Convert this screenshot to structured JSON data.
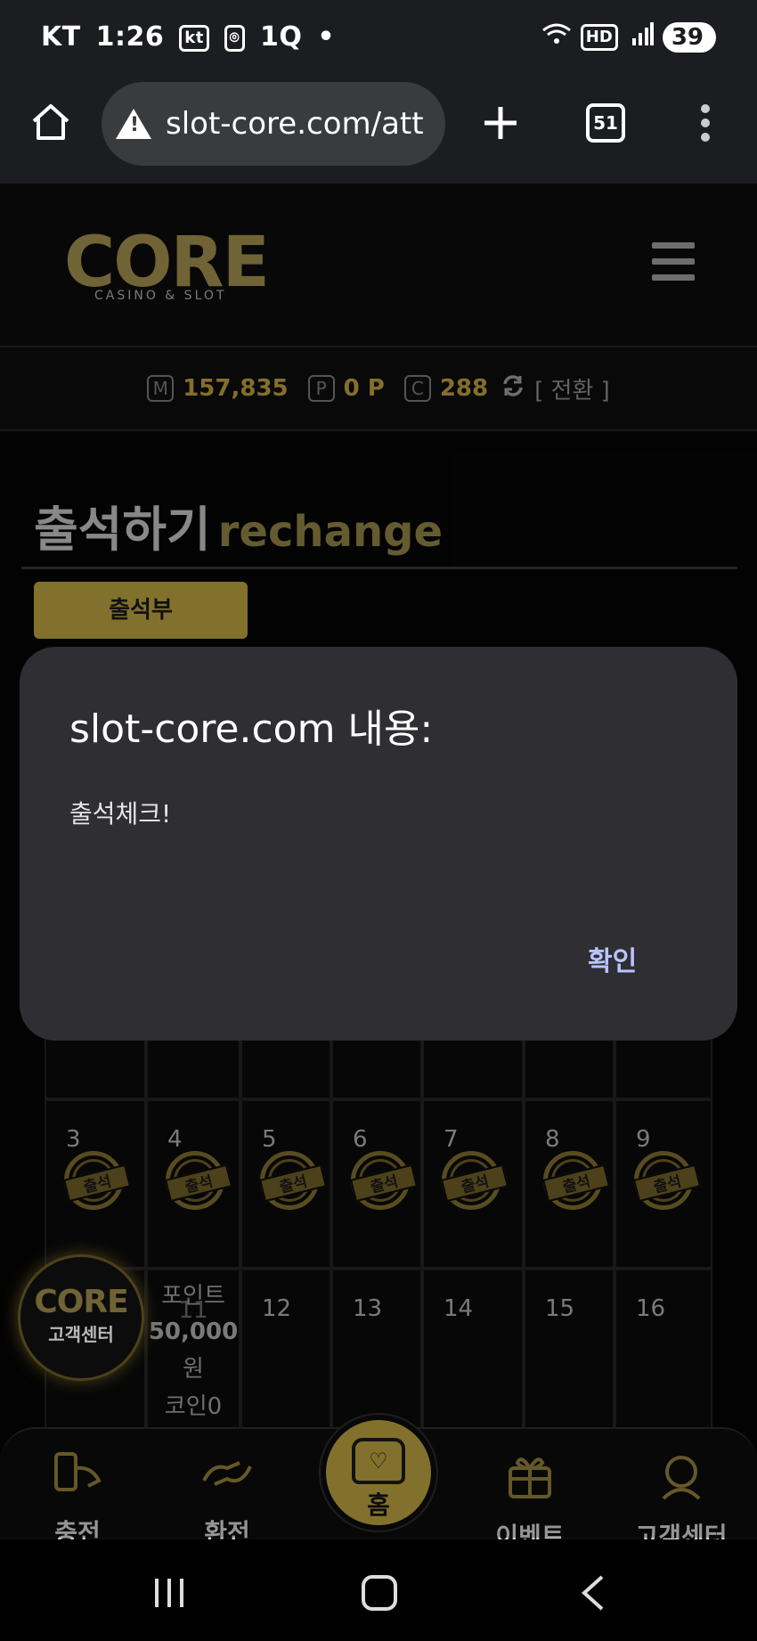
{
  "status_bar": {
    "carrier": "KT",
    "time": "1:26",
    "left_icons": [
      "kt",
      "⌾",
      "1Q",
      "•"
    ],
    "hd": "HD",
    "battery": "39"
  },
  "browser": {
    "url": "slot-core.com/att",
    "tab_count": "51"
  },
  "site": {
    "logo_word": "CORE",
    "logo_sub": "CASINO & SLOT"
  },
  "balance": {
    "m_icon": "M",
    "m_value": "157,835",
    "p_icon": "P",
    "p_value": "0 P",
    "c_icon": "C",
    "c_value": "288",
    "convert": "[ 전환 ]"
  },
  "page": {
    "title_ko": "출석하기",
    "title_en": "rechange",
    "tab": "출석부"
  },
  "calendar": {
    "row2": [
      {
        "day": "3",
        "stamp": "출석"
      },
      {
        "day": "4",
        "stamp": "출석"
      },
      {
        "day": "5",
        "stamp": "출석"
      },
      {
        "day": "6",
        "stamp": "출석"
      },
      {
        "day": "7",
        "stamp": "출석"
      },
      {
        "day": "8",
        "stamp": "출석"
      },
      {
        "day": "9",
        "stamp": "출석"
      }
    ],
    "row3": [
      {
        "day": ""
      },
      {
        "day": "11",
        "point_label": "포인트",
        "point_value": "50,000",
        "won": "원",
        "coin": "코인0"
      },
      {
        "day": "12"
      },
      {
        "day": "13"
      },
      {
        "day": "14"
      },
      {
        "day": "15"
      },
      {
        "day": "16"
      }
    ]
  },
  "support_badge": {
    "word": "CORE",
    "label": "고객센터"
  },
  "dialog": {
    "title": "slot-core.com 내용:",
    "message": "출석체크!",
    "ok": "확인"
  },
  "bottom_nav": {
    "charge": "충전",
    "exchange": "환전",
    "home": "홈",
    "event": "이벤트",
    "support": "고객센터"
  },
  "colors": {
    "gold": "#b59d3f",
    "dialog_bg": "#2e2e33",
    "ok_text": "#b8c4ff"
  }
}
